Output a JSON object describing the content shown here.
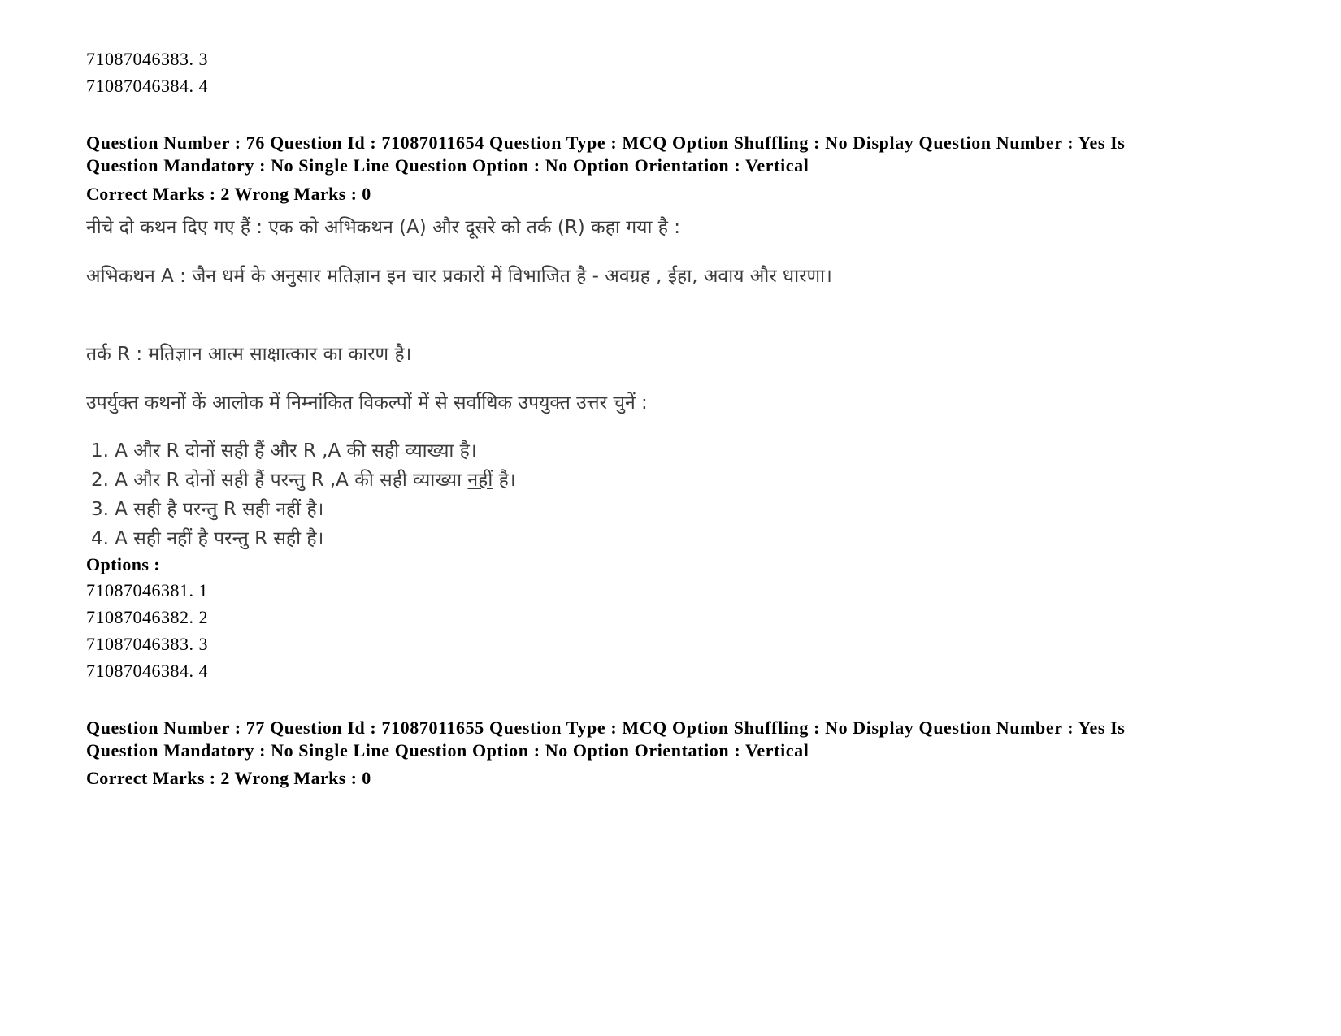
{
  "prev_options_tail": [
    {
      "id": "71087046383",
      "num": "3"
    },
    {
      "id": "71087046384",
      "num": "4"
    }
  ],
  "question76": {
    "meta_line1": "Question Number : 76 Question Id : 71087011654 Question Type : MCQ Option Shuffling : No Display Question Number : Yes Is",
    "meta_line2": "Question Mandatory : No Single Line Question Option : No Option Orientation : Vertical",
    "marks": "Correct Marks : 2 Wrong Marks : 0",
    "intro": "नीचे दो कथन दिए गए हैं  : एक को अभिकथन (A) और दूसरे को तर्क (R) कहा गया है :",
    "assertion": "अभिकथन A : जैन धर्म के अनुसार मतिज्ञान इन चार प्रकारों में  विभाजित है - अवग्रह , ईहा, अवाय और  धारणा।",
    "reason": "तर्क R : मतिज्ञान आत्म साक्षात्कार का कारण है।",
    "instruction": "उपर्युक्त कथनों कें आलोक में निम्नांकित विकल्पों में से सर्वाधिक उपयुक्त उत्तर चुनें :",
    "choices": [
      {
        "text": "1. A और R दोनों सही हैं और R ,A की सही व्याख्या है।"
      },
      {
        "text_before": "2. A और R दोनों सही हैं परन्तु R ,A की सही व्याख्या ",
        "text_underlined": "नहीं",
        "text_after": " है।"
      },
      {
        "text": "3. A सही है परन्तु R सही नहीं है।"
      },
      {
        "text": "4. A सही नहीं है परन्तु R सही है।"
      }
    ],
    "options_label": "Options :",
    "options": [
      {
        "id": "71087046381",
        "num": "1"
      },
      {
        "id": "71087046382",
        "num": "2"
      },
      {
        "id": "71087046383",
        "num": "3"
      },
      {
        "id": "71087046384",
        "num": "4"
      }
    ]
  },
  "question77": {
    "meta_line1": "Question Number : 77 Question Id : 71087011655 Question Type : MCQ Option Shuffling : No Display Question Number : Yes Is",
    "meta_line2": "Question Mandatory : No Single Line Question Option : No Option Orientation : Vertical",
    "marks": "Correct Marks : 2 Wrong Marks : 0"
  }
}
